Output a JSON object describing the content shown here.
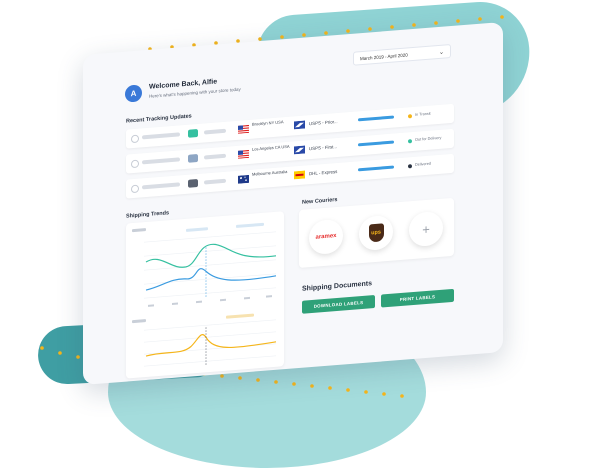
{
  "header": {
    "avatar_letter": "A",
    "welcome_title": "Welcome Back, Alfie",
    "welcome_subtitle": "Here's what's happening with your store today",
    "date_range": "March 2019 - April 2020"
  },
  "tracking": {
    "title": "Recent Tracking Updates",
    "rows": [
      {
        "location": "Brooklyn NY USA",
        "carrier": "USPS - Prior...",
        "status": "In Transit",
        "status_color": "#f5b51a"
      },
      {
        "location": "Los Angeles CA USA",
        "carrier": "USPS - First...",
        "status": "Out for Delivery",
        "status_color": "#35c0a0"
      },
      {
        "location": "Melbourne Australia",
        "carrier": "DHL - Express",
        "status": "Delivered",
        "status_color": "#2a3342"
      }
    ]
  },
  "shipping_trends": {
    "title": "Shipping Trends"
  },
  "new_couriers": {
    "title": "New Couriers",
    "items": [
      {
        "name": "aramex",
        "label": "aramex"
      },
      {
        "name": "ups",
        "label": "ups"
      },
      {
        "name": "add",
        "label": "+"
      }
    ]
  },
  "shipping_documents": {
    "title": "Shipping Documents",
    "download_label": "DOWNLOAD LABELS",
    "print_label": "PRINT LABELS"
  },
  "colors": {
    "accent": "#2fa178",
    "teal": "#8fd3d4",
    "blue": "#3a9be0",
    "orange": "#f5b51a"
  }
}
